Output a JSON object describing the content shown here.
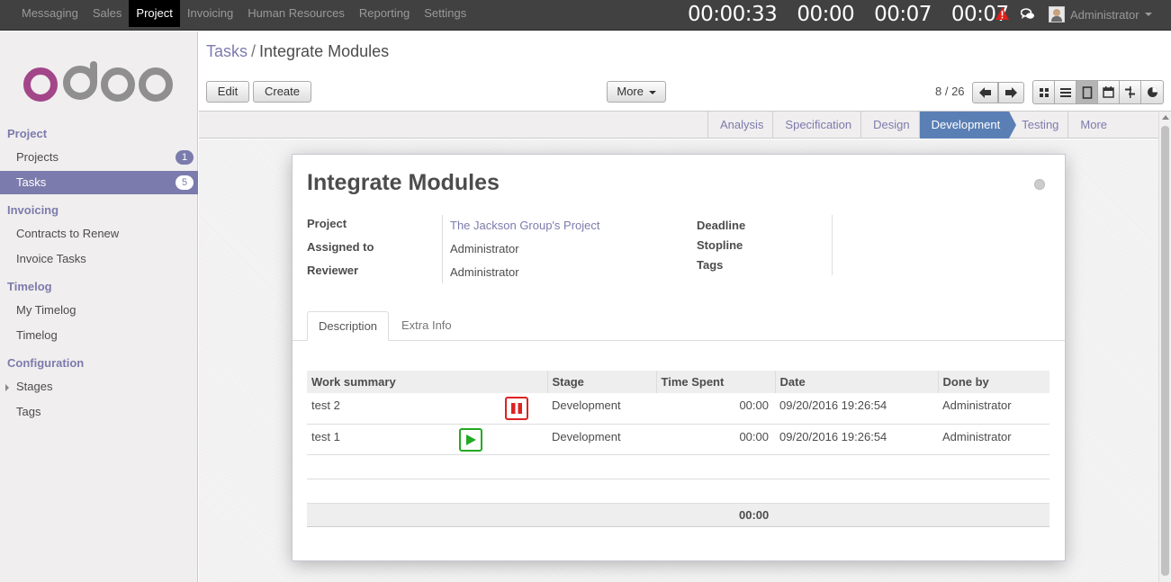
{
  "topmenu": [
    "Messaging",
    "Sales",
    "Project",
    "Invoicing",
    "Human Resources",
    "Reporting",
    "Settings"
  ],
  "timers": [
    "00:00:33",
    "00:00",
    "00:07",
    "00:07"
  ],
  "user": {
    "name": "Administrator"
  },
  "sidebar": {
    "project_header": "Project",
    "projects": "Projects",
    "projects_badge": "1",
    "tasks": "Tasks",
    "tasks_badge": "5",
    "invoicing_header": "Invoicing",
    "contracts": "Contracts to Renew",
    "invoice_tasks": "Invoice Tasks",
    "timelog_header": "Timelog",
    "my_timelog": "My Timelog",
    "timelog": "Timelog",
    "config_header": "Configuration",
    "stages": "Stages",
    "tags": "Tags"
  },
  "breadcrumb": {
    "parent": "Tasks",
    "sep": "/",
    "current": "Integrate Modules"
  },
  "buttons": {
    "edit": "Edit",
    "create": "Create",
    "more": "More"
  },
  "pager": "8 / 26",
  "stages": [
    "Analysis",
    "Specification",
    "Design",
    "Development",
    "Testing",
    "More"
  ],
  "active_stage": "Development",
  "form": {
    "title": "Integrate Modules",
    "project_label": "Project",
    "project_value": "The Jackson Group's Project",
    "assigned_label": "Assigned to",
    "assigned_value": "Administrator",
    "reviewer_label": "Reviewer",
    "reviewer_value": "Administrator",
    "deadline_label": "Deadline",
    "stopline_label": "Stopline",
    "tags_label": "Tags"
  },
  "tabs": [
    "Description",
    "Extra Info"
  ],
  "worklog": {
    "columns": [
      "Work summary",
      "Stage",
      "Time Spent",
      "Date",
      "Done by"
    ],
    "rows": [
      {
        "summary": "test 2",
        "stage": "Development",
        "time": "00:00",
        "date": "09/20/2016 19:26:54",
        "by": "Administrator",
        "timer": "stop"
      },
      {
        "summary": "test 1",
        "stage": "Development",
        "time": "00:00",
        "date": "09/20/2016 19:26:54",
        "by": "Administrator",
        "timer": "play"
      }
    ],
    "total": "00:00"
  },
  "colors": {
    "brand": "#7c7bad",
    "active_stage": "#5a7fb5",
    "topbar": "#414141"
  }
}
